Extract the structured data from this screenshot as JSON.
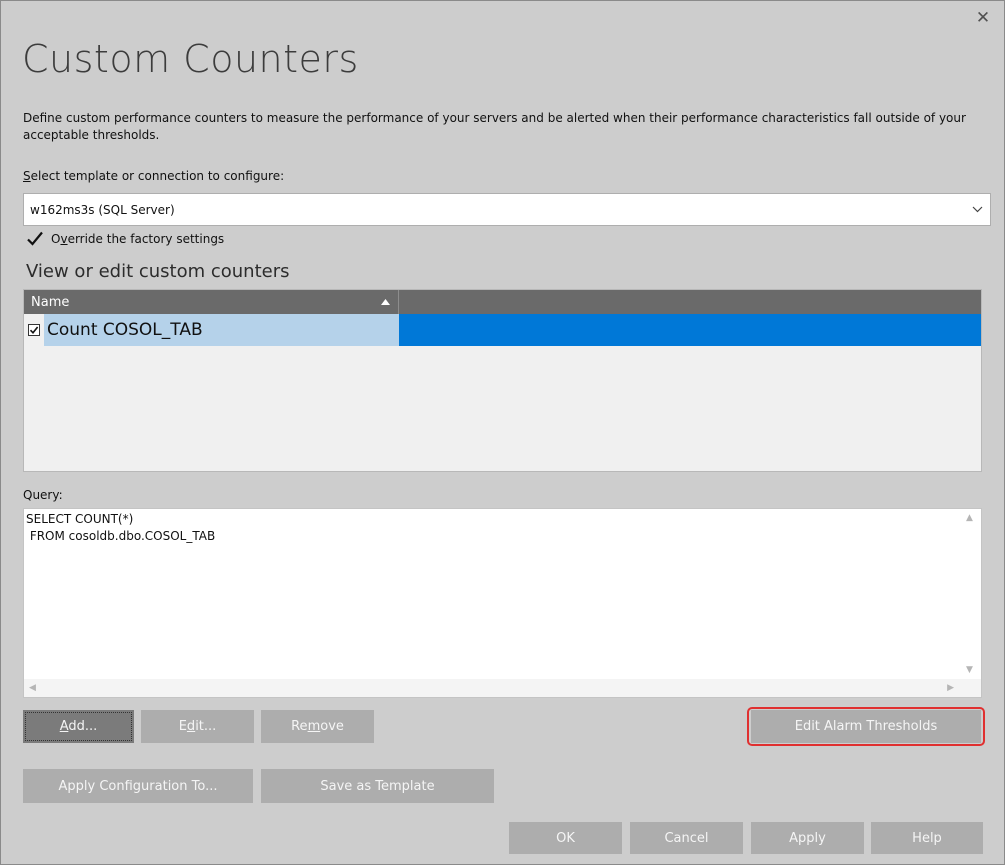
{
  "dialog": {
    "title": "Custom Counters",
    "description": "Define custom performance counters to measure the performance of your servers and be alerted when their performance characteristics fall outside of your acceptable thresholds.",
    "close_icon": "close-icon"
  },
  "template_select": {
    "label": "Select template or connection to configure:",
    "value": "w162ms3s (SQL Server)",
    "icon": "chevron-down-icon"
  },
  "override": {
    "label": "Override the factory settings",
    "checked": true
  },
  "counters": {
    "section_title": "View or edit custom counters",
    "columns": [
      "Name"
    ],
    "sort_icon": "sort-ascending-icon",
    "rows": [
      {
        "name": "Count COSOL_TAB",
        "checked": true
      }
    ]
  },
  "query": {
    "label": "Query:",
    "text": "SELECT COUNT(*)\n FROM cosoldb.dbo.COSOL_TAB"
  },
  "buttons": {
    "add": "Add...",
    "edit": "Edit...",
    "remove": "Remove",
    "edit_alarm_thresholds": "Edit Alarm Thresholds",
    "apply_configuration_to": "Apply Configuration To...",
    "save_as_template": "Save as Template",
    "ok": "OK",
    "cancel": "Cancel",
    "apply": "Apply",
    "help": "Help"
  },
  "colors": {
    "dialog_bg": "#cdcdcd",
    "grid_header": "#6a6a6a",
    "row_selected": "#b5d2ea",
    "row_selected_accent": "#0078d7",
    "button": "#adadad",
    "button_focused": "#7b7b7b",
    "highlight": "#e03030"
  }
}
